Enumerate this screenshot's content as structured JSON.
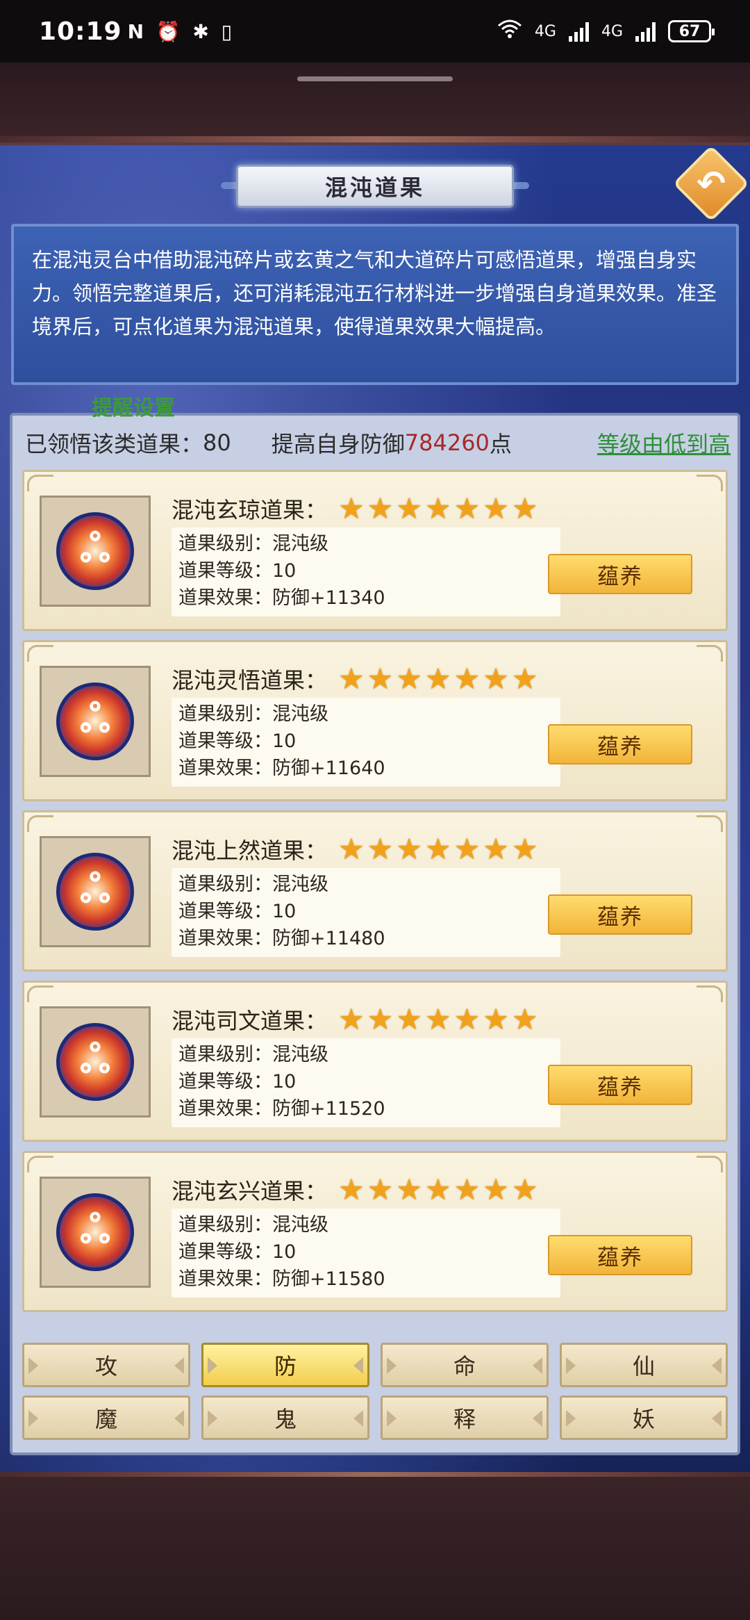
{
  "status_bar": {
    "time": "10:19",
    "left_icons": "N ⏰ ✱ ▯",
    "wifi_label": "6",
    "net1": "4G",
    "net2": "4G",
    "battery": "67"
  },
  "title": "混沌道果",
  "description": "在混沌灵台中借助混沌碎片或玄黄之气和大道碎片可感悟道果，增强自身实力。领悟完整道果后，还可消耗混沌五行材料进一步增强自身道果效果。准圣境界后，可点化道果为混沌道果，使得道果效果大幅提高。",
  "remind_label": "提醒设置",
  "summary": {
    "learned_label": "已领悟该类道果：",
    "learned_count": "80",
    "boost_prefix": "提高自身防御",
    "boost_value": "784260",
    "boost_suffix": "点",
    "sort_label": "等级由低到高"
  },
  "cards": [
    {
      "name": "混沌玄琼道果：",
      "stars": 7,
      "rank": "道果级别：混沌级",
      "level": "道果等级：10",
      "effect": "道果效果：防御+11340",
      "button": "蕴养"
    },
    {
      "name": "混沌灵悟道果：",
      "stars": 7,
      "rank": "道果级别：混沌级",
      "level": "道果等级：10",
      "effect": "道果效果：防御+11640",
      "button": "蕴养"
    },
    {
      "name": "混沌上然道果：",
      "stars": 7,
      "rank": "道果级别：混沌级",
      "level": "道果等级：10",
      "effect": "道果效果：防御+11480",
      "button": "蕴养"
    },
    {
      "name": "混沌司文道果：",
      "stars": 7,
      "rank": "道果级别：混沌级",
      "level": "道果等级：10",
      "effect": "道果效果：防御+11520",
      "button": "蕴养"
    },
    {
      "name": "混沌玄兴道果：",
      "stars": 7,
      "rank": "道果级别：混沌级",
      "level": "道果等级：10",
      "effect": "道果效果：防御+11580",
      "button": "蕴养"
    }
  ],
  "tabs": [
    {
      "label": "攻",
      "active": false
    },
    {
      "label": "防",
      "active": true
    },
    {
      "label": "命",
      "active": false
    },
    {
      "label": "仙",
      "active": false
    },
    {
      "label": "魔",
      "active": false
    },
    {
      "label": "鬼",
      "active": false
    },
    {
      "label": "释",
      "active": false
    },
    {
      "label": "妖",
      "active": false
    }
  ],
  "colors": {
    "accent_orange": "#f2a21a",
    "value_red": "#a52a2a",
    "link_green": "#2f8f3a",
    "panel_blue": "#243a8e"
  },
  "icons": {
    "back": "back-arrow-icon",
    "item": "chaos-orb-icon",
    "star": "star-icon"
  }
}
